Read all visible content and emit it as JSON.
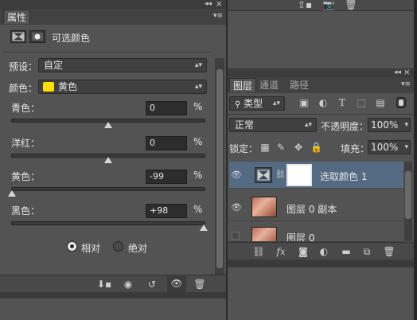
{
  "properties_panel": {
    "tab_title": "属性",
    "adjustment_title": "可选颜色",
    "preset_label": "预设：",
    "preset_value": "自定",
    "colors_label": "颜色：",
    "colors_value": "黄色",
    "colors_swatch": "#ffe000",
    "sliders": [
      {
        "label": "青色：",
        "value": "0",
        "unit": "%",
        "level": 0
      },
      {
        "label": "洋红：",
        "value": "0",
        "unit": "%",
        "level": 0
      },
      {
        "label": "黄色：",
        "value": "-99",
        "unit": "%",
        "level": -99
      },
      {
        "label": "黑色：",
        "value": "+98",
        "unit": "%",
        "level": 98
      }
    ],
    "method_relative": "相对",
    "method_absolute": "绝对",
    "method_selected": "relative"
  },
  "layers_panel": {
    "tabs": [
      "图层",
      "通道",
      "路径"
    ],
    "filter_label": "类型",
    "blend_mode": "正常",
    "opacity_label": "不透明度：",
    "opacity_value": "100%",
    "lock_label": "锁定：",
    "fill_label": "填充：",
    "fill_value": "100%",
    "layers": [
      {
        "name": "选取颜色 1",
        "visible": true,
        "selected": true
      },
      {
        "name": "图层 0 副本",
        "visible": true,
        "selected": false
      },
      {
        "name": "图层 0",
        "visible": false,
        "selected": false
      }
    ],
    "footer_fx": "fx"
  },
  "colors": {
    "panel_bg": "#535353",
    "selected_row": "#546a82",
    "accent_yellow": "#ffe000"
  }
}
